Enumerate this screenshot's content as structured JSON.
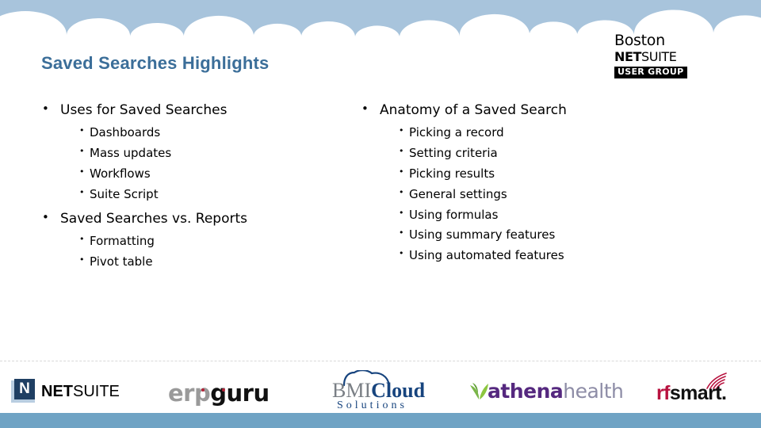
{
  "slide": {
    "title": "Saved Searches Highlights",
    "accent_color": "#3b6e99",
    "sky_color": "#a8c4dc",
    "footer_bar_color": "#6fa3c4"
  },
  "brand_logo": {
    "line1": "Boston",
    "line2_bold": "NET",
    "line2_regular": "SUITE",
    "badge": "USER GROUP"
  },
  "columns": {
    "left": [
      {
        "label": "Uses for Saved Searches",
        "children": [
          "Dashboards",
          "Mass updates",
          "Workflows",
          "Suite Script"
        ]
      },
      {
        "label": "Saved Searches vs. Reports",
        "children": [
          "Formatting",
          "Pivot table"
        ]
      }
    ],
    "right": [
      {
        "label": "Anatomy of a Saved Search",
        "children": [
          "Picking a record",
          "Setting criteria",
          "Picking results",
          "General settings",
          "Using formulas",
          "Using summary features",
          "Using automated features"
        ]
      }
    ]
  },
  "bullets": {
    "level1": "•",
    "level2": "•"
  },
  "footer_logos": {
    "netsuite": {
      "mark_letter": "N",
      "word_bold": "NET",
      "word_regular": "SUITE",
      "mark_bg": "#b8cde0",
      "mark_fg": "#1f3f63"
    },
    "erpguru": {
      "part_gray": "erp",
      "part_black": "guru",
      "gray": "#9a9a9a",
      "black": "#111111",
      "dot_color": "#b32035"
    },
    "bmicloud": {
      "part_gray": "BMI",
      "part_blue": "Cloud",
      "line2": "Solutions",
      "gray": "#7a7f85",
      "blue": "#17447e"
    },
    "athenahealth": {
      "part_bold": "athena",
      "part_light": "health",
      "bold_color": "#55287f",
      "light_color": "#8d8ca6",
      "leaf_color": "#7ab648"
    },
    "rfsmart": {
      "part_red": "rf",
      "part_black": "smart.",
      "red": "#b8123f",
      "black": "#111111"
    }
  }
}
